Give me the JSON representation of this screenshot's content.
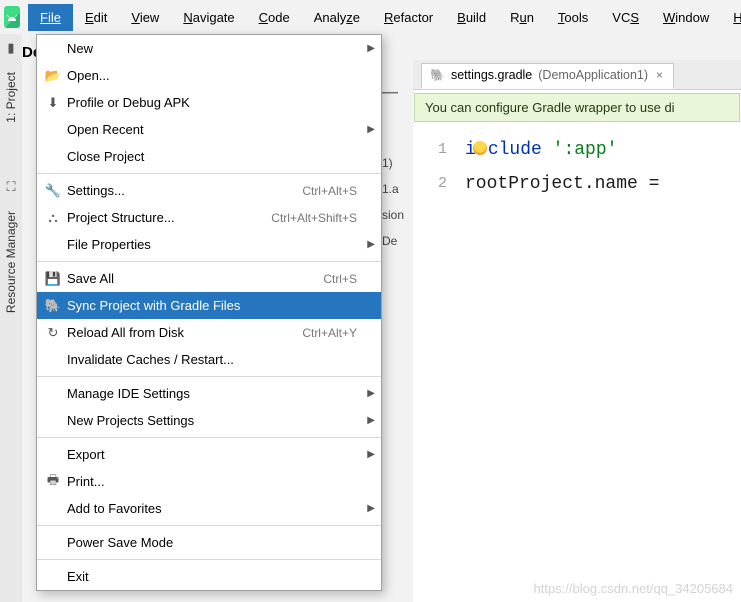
{
  "menubar": {
    "items": [
      {
        "label": "File",
        "open": true
      },
      {
        "label": "Edit"
      },
      {
        "label": "View"
      },
      {
        "label": "Navigate"
      },
      {
        "label": "Code"
      },
      {
        "label": "Analyze"
      },
      {
        "label": "Refactor"
      },
      {
        "label": "Build"
      },
      {
        "label": "Run"
      },
      {
        "label": "Tools"
      },
      {
        "label": "VCS"
      },
      {
        "label": "Window"
      },
      {
        "label": "H"
      }
    ]
  },
  "left_tools": {
    "project_label": "1: Project",
    "resource_mgr_label": "Resource Manager"
  },
  "project_prefix": "De",
  "toolbar_fragment": {
    "dash": "—"
  },
  "file_menu": {
    "items": [
      {
        "label": "New",
        "icon": "",
        "submenu": true
      },
      {
        "label": "Open...",
        "icon": "📂"
      },
      {
        "label": "Profile or Debug APK",
        "icon": "⬇"
      },
      {
        "label": "Open Recent",
        "submenu": true
      },
      {
        "label": "Close Project"
      },
      {
        "sep": true
      },
      {
        "label": "Settings...",
        "icon": "🔧",
        "shortcut": "Ctrl+Alt+S"
      },
      {
        "label": "Project Structure...",
        "icon": "⛬",
        "shortcut": "Ctrl+Alt+Shift+S"
      },
      {
        "label": "File Properties",
        "submenu": true
      },
      {
        "sep": true
      },
      {
        "label": "Save All",
        "icon": "💾",
        "shortcut": "Ctrl+S"
      },
      {
        "label": "Sync Project with Gradle Files",
        "icon": "🐘",
        "selected": true
      },
      {
        "label": "Reload All from Disk",
        "icon": "↻",
        "shortcut": "Ctrl+Alt+Y"
      },
      {
        "label": "Invalidate Caches / Restart..."
      },
      {
        "sep": true
      },
      {
        "label": "Manage IDE Settings",
        "submenu": true
      },
      {
        "label": "New Projects Settings",
        "submenu": true
      },
      {
        "sep": true
      },
      {
        "label": "Export",
        "submenu": true
      },
      {
        "label": "Print...",
        "icon": "🖶"
      },
      {
        "label": "Add to Favorites",
        "submenu": true
      },
      {
        "sep": true
      },
      {
        "label": "Power Save Mode"
      },
      {
        "sep": true
      },
      {
        "label": "Exit"
      }
    ]
  },
  "peek_behind": {
    "l1": ")",
    "l2": "1)",
    "l3": "1.a",
    "l4": "sion",
    "l5": "De"
  },
  "editor": {
    "tab_file": "settings.gradle",
    "tab_context": "(DemoApplication1)",
    "banner": "You can configure Gradle wrapper to use di",
    "line_nums": [
      "1",
      "2"
    ],
    "code": {
      "l1_prefix": "i",
      "l1_kw_rest": "clude",
      "l1_str": "':app'",
      "l2_lhs": "rootProject.name",
      "l2_eq": "="
    }
  },
  "watermark": "https://blog.csdn.net/qq_34205684"
}
